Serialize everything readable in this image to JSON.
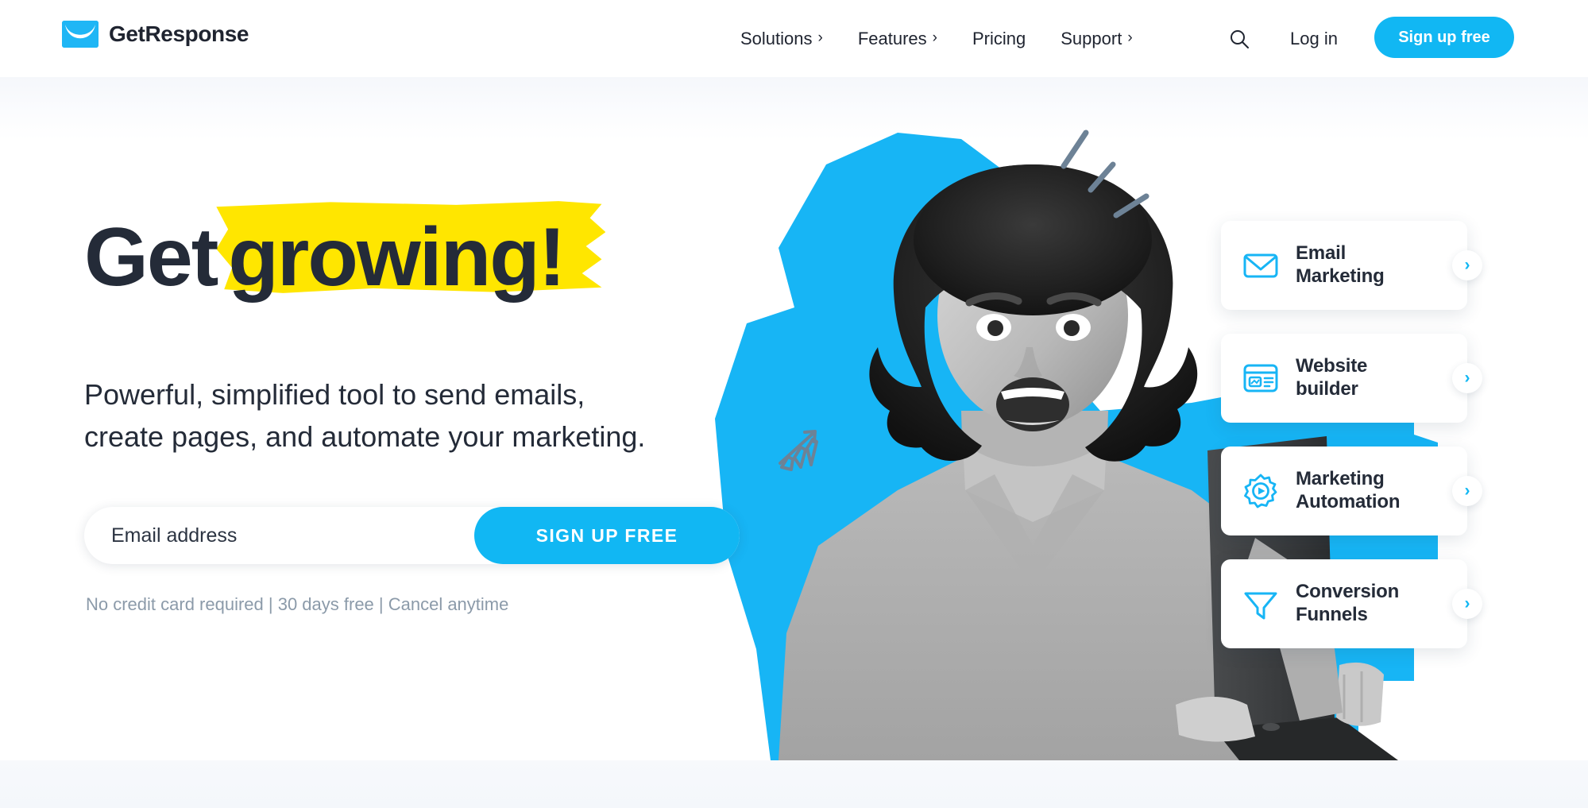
{
  "brand": {
    "name": "GetResponse",
    "logo_icon": "envelope-icon",
    "accent_color": "#11b7f3",
    "highlight_color": "#ffe600",
    "dark_color": "#242b38"
  },
  "header": {
    "nav": [
      {
        "label": "Solutions",
        "caret": "›",
        "has_menu": true
      },
      {
        "label": "Features",
        "caret": "›",
        "has_menu": true
      },
      {
        "label": "Pricing",
        "caret": "",
        "has_menu": false
      },
      {
        "label": "Support",
        "caret": "›",
        "has_menu": true
      }
    ],
    "search_icon": "search-icon",
    "login_label": "Log in",
    "signup_label": "Sign up free"
  },
  "hero": {
    "headline_plain": "Get",
    "headline_highlight": "growing!",
    "subheading_line1": "Powerful, simplified tool to send emails,",
    "subheading_line2": "create pages, and automate your marketing.",
    "form": {
      "email_placeholder": "Email address",
      "email_value": "",
      "submit_label": "SIGN UP FREE"
    },
    "disclaimer": "No credit card required | 30 days free | Cancel anytime",
    "image_alt": "Smiling woman holding a laptop on a cyan cut-out background",
    "doodle_icon": "growth-chart-doodle-icon",
    "sparkle_icon": "sparkle-lines-icon"
  },
  "feature_cards": [
    {
      "icon": "envelope-outline-icon",
      "line1": "Email",
      "line2": "Marketing",
      "chevron": "›"
    },
    {
      "icon": "website-builder-icon",
      "line1": "Website",
      "line2": "builder",
      "chevron": "›"
    },
    {
      "icon": "gear-play-icon",
      "line1": "Marketing",
      "line2": "Automation",
      "chevron": "›"
    },
    {
      "icon": "funnel-icon",
      "line1": "Conversion",
      "line2": "Funnels",
      "chevron": "›"
    }
  ]
}
